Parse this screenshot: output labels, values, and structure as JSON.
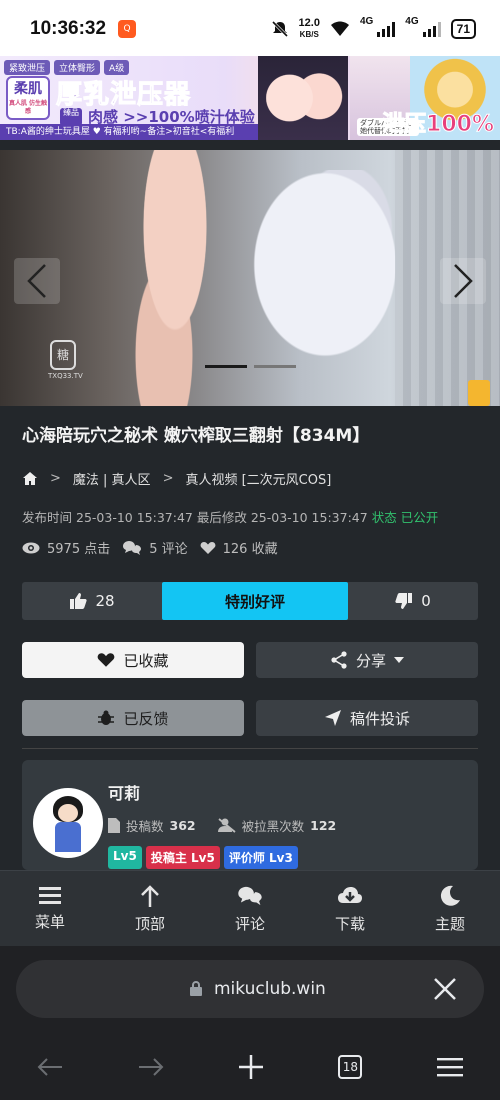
{
  "status": {
    "time": "10:36:32",
    "app_badge": "Q",
    "speed": "12.0",
    "speed_unit": "KB/S",
    "net1": "4G",
    "net2": "4G",
    "battery": "71"
  },
  "ad": {
    "tags": [
      "紧致泄压",
      "立体臀形",
      "A级"
    ],
    "soft_label": "柔肌",
    "soft_sub": "真人肌 仿生触感",
    "title": "厚乳泄压器",
    "badge": "臻品",
    "subtitle": "肉感 >>100%喷汁体验",
    "bottom": "TB:A酱的绅士玩具屋 ♥ 有福利哟~备注>初音社<有福利",
    "press": "ダブルパイン 让她代替你的手把",
    "hundred": "泄压100%"
  },
  "video": {
    "watermark": "糖",
    "watermark_text": "TXQ33.TV"
  },
  "post": {
    "title": "心海陪玩穴之秘术 嫩穴榨取三翻射【834M】",
    "breadcrumb": [
      "魔法 | 真人区",
      "真人视频 [二次元风COS]"
    ],
    "published_label": "发布时间",
    "published": "25-03-10 15:37:47",
    "modified_label": "最后修改",
    "modified": "25-03-10 15:37:47",
    "status_label": "状态",
    "status": "已公开",
    "views": "5975 点击",
    "comments": "5 评论",
    "favorites": "126 收藏"
  },
  "rating": {
    "likes": "28",
    "label": "特别好评",
    "dislikes": "0"
  },
  "actions": {
    "fav": "已收藏",
    "share": "分享",
    "feedback": "已反馈",
    "report": "稿件投诉"
  },
  "author": {
    "name": "可莉",
    "posts_label": "投稿数",
    "posts": "362",
    "blocked_label": "被拉黑次数",
    "blocked": "122",
    "badges": [
      "Lv5",
      "投稿主 Lv5",
      "评价师 Lv3"
    ]
  },
  "nav": [
    "菜单",
    "顶部",
    "评论",
    "下载",
    "主题"
  ],
  "browser": {
    "url": "mikuclub.win",
    "tabs": "18"
  },
  "colors": {
    "accent": "#13c5f3",
    "green": "#32c26e",
    "bg": "#23272b"
  }
}
